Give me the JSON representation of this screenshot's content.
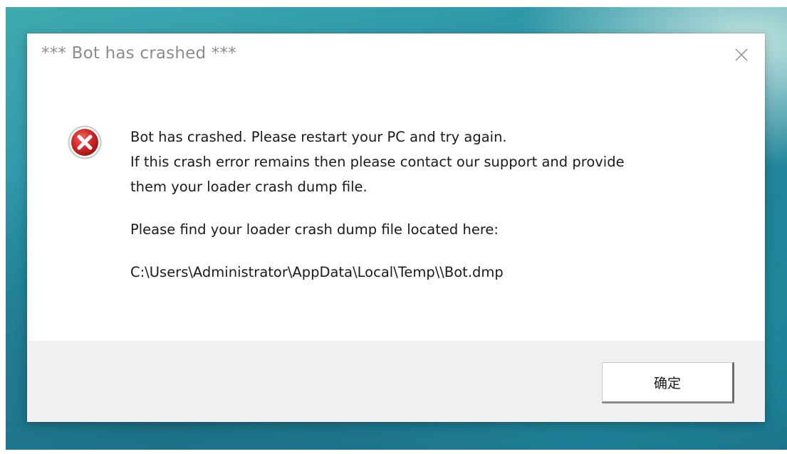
{
  "dialog": {
    "title": "*** Bot has crashed ***",
    "close_icon": "close-icon",
    "error_icon": "error-icon",
    "error_icon_color": "#d42a2a",
    "message_lines": [
      "Bot has crashed. Please restart your PC and try again.",
      "If this crash error remains then please contact our support and provide",
      "them your loader crash dump file."
    ],
    "location_line": "Please find your loader crash dump file located here:",
    "dump_path": "C:\\Users\\Administrator\\AppData\\Local\\Temp\\\\Bot.dmp",
    "ok_label": "确定"
  },
  "colors": {
    "title_text": "#8c8c8c",
    "footer_bg": "#f0f0f0",
    "wallpaper": "#2a93a6"
  }
}
